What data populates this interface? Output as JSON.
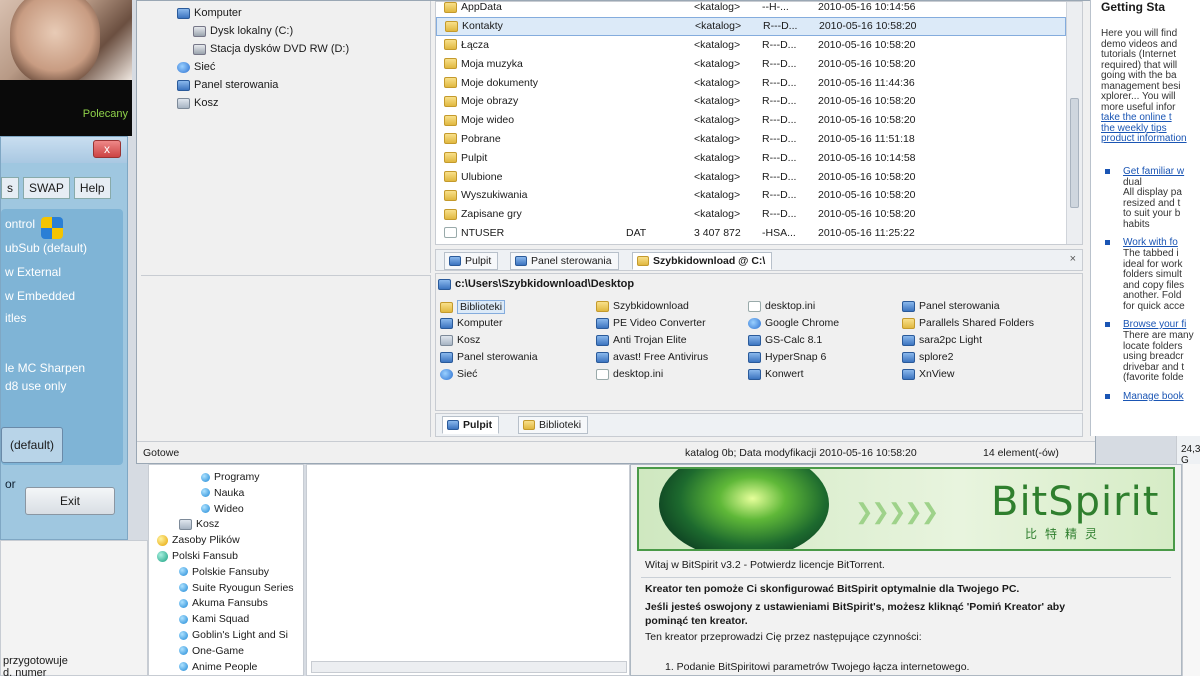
{
  "left_window": {
    "promo_text": "Polecany",
    "close_label": "x",
    "menu": [
      "s",
      "SWAP",
      "Help"
    ],
    "options": [
      "ontrol",
      "ubSub (default)",
      "w External",
      "w Embedded",
      "itles",
      "le MC Sharpen",
      "d8 use only"
    ],
    "default_button": "(default)",
    "exit_button": "Exit",
    "left_fragment_1": "or",
    "bottom_texts": [
      "przygotowuje",
      "d. numer"
    ]
  },
  "explorer": {
    "tree": [
      {
        "label": "Komputer",
        "icon": "computer-icon"
      },
      {
        "label": "Dysk lokalny (C:)",
        "icon": "drive-icon"
      },
      {
        "label": "Stacja dysków DVD RW (D:)",
        "icon": "dvd-icon"
      },
      {
        "label": "Sieć",
        "icon": "network-icon"
      },
      {
        "label": "Panel sterowania",
        "icon": "control-panel-icon"
      },
      {
        "label": "Kosz",
        "icon": "recycle-bin-icon"
      }
    ],
    "files": [
      {
        "name": "AppData",
        "ext": "",
        "size": "<katalog>",
        "attr": "--H-...",
        "date": "2010-05-16 10:14:56",
        "icon": "folder-icon"
      },
      {
        "name": "Kontakty",
        "ext": "",
        "size": "<katalog>",
        "attr": "R---D...",
        "date": "2010-05-16 10:58:20",
        "icon": "folder-icon",
        "selected": true
      },
      {
        "name": "Łącza",
        "ext": "",
        "size": "<katalog>",
        "attr": "R---D...",
        "date": "2010-05-16 10:58:20",
        "icon": "folder-icon"
      },
      {
        "name": "Moja muzyka",
        "ext": "",
        "size": "<katalog>",
        "attr": "R---D...",
        "date": "2010-05-16 10:58:20",
        "icon": "folder-icon"
      },
      {
        "name": "Moje dokumenty",
        "ext": "",
        "size": "<katalog>",
        "attr": "R---D...",
        "date": "2010-05-16 11:44:36",
        "icon": "folder-icon"
      },
      {
        "name": "Moje obrazy",
        "ext": "",
        "size": "<katalog>",
        "attr": "R---D...",
        "date": "2010-05-16 10:58:20",
        "icon": "folder-icon"
      },
      {
        "name": "Moje wideo",
        "ext": "",
        "size": "<katalog>",
        "attr": "R---D...",
        "date": "2010-05-16 10:58:20",
        "icon": "folder-icon"
      },
      {
        "name": "Pobrane",
        "ext": "",
        "size": "<katalog>",
        "attr": "R---D...",
        "date": "2010-05-16 11:51:18",
        "icon": "folder-icon"
      },
      {
        "name": "Pulpit",
        "ext": "",
        "size": "<katalog>",
        "attr": "R---D...",
        "date": "2010-05-16 10:14:58",
        "icon": "folder-icon"
      },
      {
        "name": "Ulubione",
        "ext": "",
        "size": "<katalog>",
        "attr": "R---D...",
        "date": "2010-05-16 10:58:20",
        "icon": "folder-icon"
      },
      {
        "name": "Wyszukiwania",
        "ext": "",
        "size": "<katalog>",
        "attr": "R---D...",
        "date": "2010-05-16 10:58:20",
        "icon": "folder-icon"
      },
      {
        "name": "Zapisane gry",
        "ext": "",
        "size": "<katalog>",
        "attr": "R---D...",
        "date": "2010-05-16 10:58:20",
        "icon": "folder-icon"
      },
      {
        "name": "NTUSER",
        "ext": "DAT",
        "size": "3 407 872",
        "attr": "-HSA...",
        "date": "2010-05-16 11:25:22",
        "icon": "file-icon"
      }
    ],
    "top_tabs": [
      {
        "label": "Pulpit",
        "active": false
      },
      {
        "label": "Panel sterowania",
        "active": false
      },
      {
        "label": "Szybkidownload @ C:\\",
        "active": true
      }
    ],
    "close_tab": "×",
    "path": "c:\\Users\\Szybkidownload\\Desktop",
    "desktop_items": [
      {
        "label": "Biblioteki",
        "icon": "libraries-icon",
        "selected": true
      },
      {
        "label": "Komputer",
        "icon": "computer-icon"
      },
      {
        "label": "Kosz",
        "icon": "recycle-bin-icon"
      },
      {
        "label": "Panel sterowania",
        "icon": "control-panel-icon"
      },
      {
        "label": "Sieć",
        "icon": "network-icon"
      },
      {
        "label": "Szybkidownload",
        "icon": "user-folder-icon"
      },
      {
        "label": "PE Video Converter",
        "icon": "app-icon"
      },
      {
        "label": "Anti Trojan Elite",
        "icon": "app-icon"
      },
      {
        "label": "avast! Free Antivirus",
        "icon": "app-icon"
      },
      {
        "label": "desktop.ini",
        "icon": "ini-file-icon"
      },
      {
        "label": "desktop.ini",
        "icon": "ini-file-icon"
      },
      {
        "label": "Google Chrome",
        "icon": "chrome-icon"
      },
      {
        "label": "GS-Calc 8.1",
        "icon": "app-icon"
      },
      {
        "label": "HyperSnap 6",
        "icon": "app-icon"
      },
      {
        "label": "Konwert",
        "icon": "app-icon"
      },
      {
        "label": "Panel sterowania",
        "icon": "control-panel-icon"
      },
      {
        "label": "Parallels Shared Folders",
        "icon": "folder-icon"
      },
      {
        "label": "sara2pc Light",
        "icon": "app-icon"
      },
      {
        "label": "splore2",
        "icon": "app-icon"
      },
      {
        "label": "XnView",
        "icon": "app-icon"
      }
    ],
    "bottom_tabs": [
      {
        "label": "Pulpit",
        "active": true
      },
      {
        "label": "Biblioteki",
        "active": false
      }
    ],
    "status": {
      "left": "Gotowe",
      "info": "katalog 0b; Data modyfikacji 2010-05-16 10:58:20",
      "count": "14 element(-ów)",
      "right": "24,3 G"
    }
  },
  "browser": {
    "heading": "Getting Sta",
    "para": [
      "Here you will find",
      "demo videos and",
      "tutorials (Internet",
      "required) that will",
      "going with the ba",
      "management besi",
      "xplorer... You will",
      "more useful infor",
      "take the online t",
      "the weekly tips",
      "product information"
    ],
    "items": [
      {
        "link": "Get familiar w",
        "lines": [
          "dual",
          "All display pa",
          "resized and t",
          "to suit your b",
          "habits"
        ]
      },
      {
        "link": "Work with fo",
        "lines": [
          "The tabbed i",
          "ideal for work",
          "folders simult",
          "and copy files",
          "another. Fold",
          "for quick acce"
        ]
      },
      {
        "link": "Browse your fi",
        "lines": [
          "There are many",
          "locate folders",
          "using breadcr",
          "drivebar and t",
          "(favorite folde"
        ]
      },
      {
        "link": "Manage book",
        "lines": []
      }
    ]
  },
  "bottom_tree": [
    {
      "label": "Programy",
      "icon": "dot-blue",
      "indent": 2
    },
    {
      "label": "Nauka",
      "icon": "dot-blue",
      "indent": 2
    },
    {
      "label": "Wideo",
      "icon": "dot-blue",
      "indent": 2
    },
    {
      "label": "Kosz",
      "icon": "recycle-bin-icon",
      "indent": 1
    },
    {
      "label": "Zasoby Plików",
      "icon": "dot-yellow",
      "indent": 0
    },
    {
      "label": "Polski Fansub",
      "icon": "dot-teal",
      "indent": 0
    },
    {
      "label": "Polskie Fansuby",
      "icon": "dot-blue",
      "indent": 1
    },
    {
      "label": "Suite Ryougun Series",
      "icon": "dot-blue",
      "indent": 1
    },
    {
      "label": "Akuma Fansubs",
      "icon": "dot-blue",
      "indent": 1
    },
    {
      "label": "Kami Squad",
      "icon": "dot-blue",
      "indent": 1
    },
    {
      "label": "Goblin's Light and Si",
      "icon": "dot-blue",
      "indent": 1
    },
    {
      "label": "One-Game",
      "icon": "dot-blue",
      "indent": 1
    },
    {
      "label": "Anime People",
      "icon": "dot-blue",
      "indent": 1
    }
  ],
  "bitspirit": {
    "logo": "BitSpirit",
    "logo_sub": "比特精灵",
    "welcome": "Witaj w BitSpirit v3.2 - Potwierdz licencje BitTorrent.",
    "line1": "Kreator ten pomoże Ci skonfigurować BitSpirit optymalnie dla Twojego PC.",
    "line2": "Jeśli jesteś oswojony z ustawieniami BitSpirit's, możesz kliknąć 'Pomiń Kreator' aby",
    "line3": "pominąć ten kreator.",
    "line4": "Ten kreator przeprowadzi Cię przez następujące czynności:",
    "step1": "1. Podanie BitSpiritowi parametrów Twojego łącza internetowego."
  }
}
